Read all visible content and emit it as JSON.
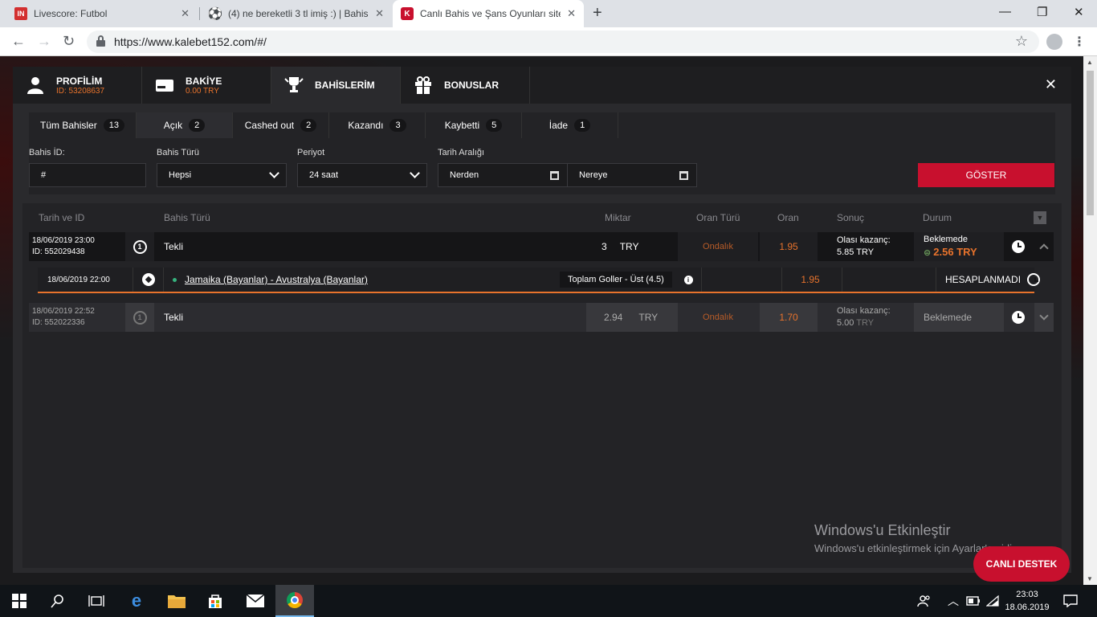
{
  "browser": {
    "tabs": [
      {
        "title": "Livescore: Futbol",
        "favicon": "IN"
      },
      {
        "title": "(4) ne bereketli 3 tl imiş :) | Bahis",
        "favicon": "soccer-ball"
      },
      {
        "title": "Canlı Bahis ve Şans Oyunları sites",
        "favicon": "K"
      }
    ],
    "url": "https://www.kalebet152.com/#/"
  },
  "modal": {
    "tabs": [
      {
        "label": "PROFİLİM",
        "sub": "ID: 53208637",
        "icon": "user-icon"
      },
      {
        "label": "BAKİYE",
        "sub": "0.00 TRY",
        "icon": "wallet-icon"
      },
      {
        "label": "BAHİSLERİM",
        "sub": "",
        "icon": "trophy-icon"
      },
      {
        "label": "BONUSLAR",
        "sub": "",
        "icon": "gift-icon"
      }
    ],
    "filter_tabs": [
      {
        "label": "Tüm Bahisler",
        "count": "13"
      },
      {
        "label": "Açık",
        "count": "2"
      },
      {
        "label": "Cashed out",
        "count": "2"
      },
      {
        "label": "Kazandı",
        "count": "3"
      },
      {
        "label": "Kaybetti",
        "count": "5"
      },
      {
        "label": "İade",
        "count": "1"
      }
    ],
    "filters": {
      "bet_id_label": "Bahis İD:",
      "bet_id_placeholder": "#",
      "bet_type_label": "Bahis Türü",
      "bet_type_value": "Hepsi",
      "period_label": "Periyot",
      "period_value": "24 saat",
      "date_range_label": "Tarih Aralığı",
      "from_placeholder": "Nerden",
      "to_placeholder": "Nereye",
      "show_button": "GÖSTER"
    },
    "table": {
      "headers": [
        "Tarih ve ID",
        "Bahis Türü",
        "Miktar",
        "Oran Türü",
        "Oran",
        "Sonuç",
        "Durum"
      ],
      "bets": [
        {
          "date": "18/06/2019 23:00",
          "id": "ID: 552029438",
          "type_number": "1",
          "type": "Tekli",
          "amount": "3",
          "currency": "TRY",
          "odds_type": "Ondalık",
          "odds": "1.95",
          "result_label": "Olası kazanç:",
          "result_value": "5.85 TRY",
          "status": "Beklemede",
          "cashout_value": "2.56 TRY",
          "selection": {
            "date": "18/06/2019 22:00",
            "match": "Jamaika (Bayanlar) - Avustralya (Bayanlar)",
            "market": "Toplam Goller - Üst (4.5)",
            "odds": "1.95",
            "status": "HESAPLANMADI"
          }
        },
        {
          "date": "18/06/2019 22:52",
          "id": "ID: 552022336",
          "type_number": "1",
          "type": "Tekli",
          "amount": "2.94",
          "currency": "TRY",
          "odds_type": "Ondalık",
          "odds": "1.70",
          "result_label": "Olası kazanç:",
          "result_value": "5.00",
          "result_currency": "TRY",
          "status": "Beklemede"
        }
      ]
    }
  },
  "watermark": {
    "line1": "Windows'u Etkinleştir",
    "line2": "Windows'u etkinleştirmek için Ayarlar'a gidin."
  },
  "live_support": "CANLI DESTEK",
  "taskbar": {
    "time": "23:03",
    "date": "18.06.2019"
  },
  "colors": {
    "accent": "#c8102e",
    "orange": "#e8732c",
    "background": "#1b1b1d"
  }
}
